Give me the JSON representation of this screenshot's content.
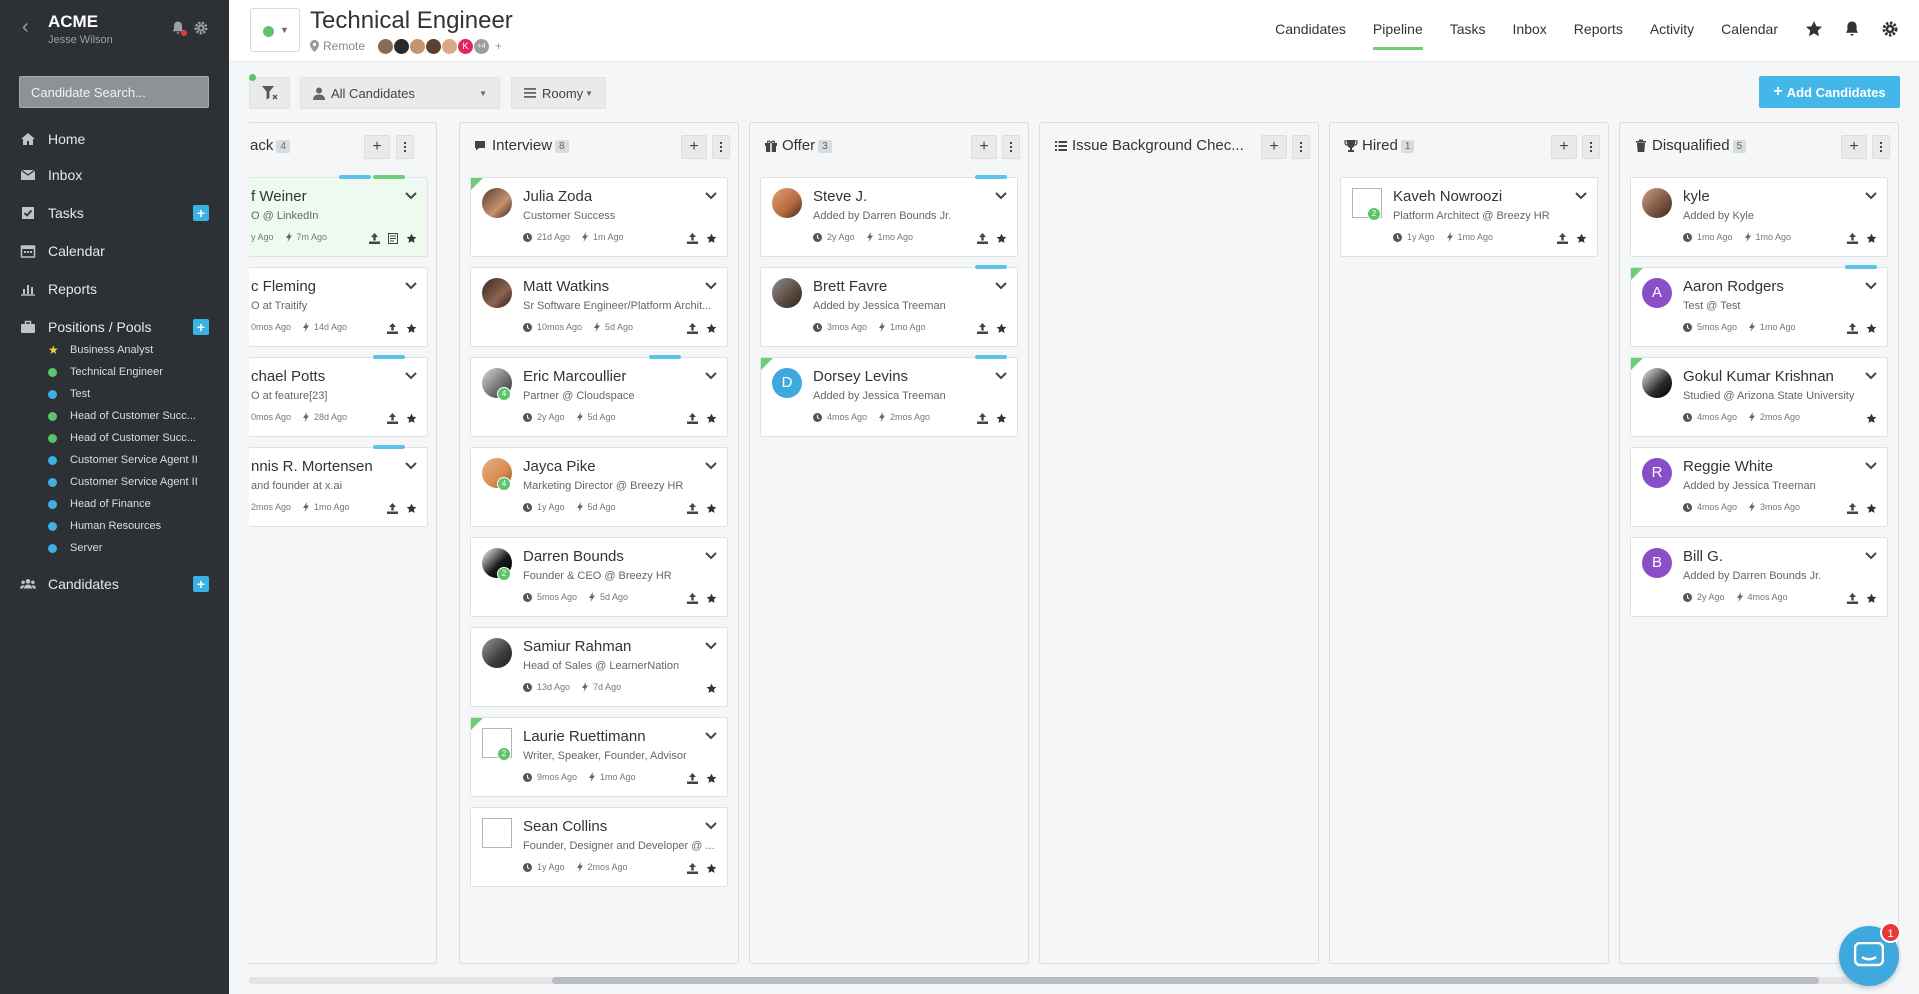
{
  "sidebar": {
    "company": "ACME",
    "user": "Jesse Wilson",
    "search_placeholder": "Candidate Search...",
    "nav": {
      "home": "Home",
      "inbox": "Inbox",
      "tasks": "Tasks",
      "calendar": "Calendar",
      "reports": "Reports",
      "positions": "Positions / Pools",
      "candidates": "Candidates"
    },
    "positions": [
      {
        "label": "Business Analyst",
        "marker": "star",
        "color": "#f4d03f"
      },
      {
        "label": "Technical Engineer",
        "marker": "dot",
        "color": "#5cc46a"
      },
      {
        "label": "Test",
        "marker": "dot",
        "color": "#3fb0e3"
      },
      {
        "label": "Head of Customer Succ...",
        "marker": "dot",
        "color": "#5cc46a"
      },
      {
        "label": "Head of Customer Succ...",
        "marker": "dot",
        "color": "#5cc46a"
      },
      {
        "label": "Customer Service Agent II",
        "marker": "dot",
        "color": "#3fb0e3"
      },
      {
        "label": "Customer Service Agent II",
        "marker": "dot",
        "color": "#3fb0e3"
      },
      {
        "label": "Head of Finance",
        "marker": "dot",
        "color": "#3fb0e3"
      },
      {
        "label": "Human Resources",
        "marker": "dot",
        "color": "#3fb0e3"
      },
      {
        "label": "Server",
        "marker": "dot",
        "color": "#3fb0e3"
      }
    ]
  },
  "header": {
    "title": "Technical Engineer",
    "location": "Remote",
    "team_more": "+4",
    "team_initial": "K",
    "nav": {
      "candidates": "Candidates",
      "pipeline": "Pipeline",
      "tasks": "Tasks",
      "inbox": "Inbox",
      "reports": "Reports",
      "activity": "Activity",
      "calendar": "Calendar"
    }
  },
  "toolbar": {
    "candidate_filter": "All Candidates",
    "view_mode": "Roomy",
    "add_button": "Add Candidates"
  },
  "columns": {
    "feedback": {
      "title": "ack",
      "count": "4",
      "cards": [
        {
          "name": "f Weiner",
          "sub": "O @ LinkedIn",
          "t1": "y Ago",
          "t2": "7m Ago"
        },
        {
          "name": "c Fleming",
          "sub": "O at Traitify",
          "t1": "0mos Ago",
          "t2": "14d Ago"
        },
        {
          "name": "chael Potts",
          "sub": "O at feature[23]",
          "t1": "0mos Ago",
          "t2": "28d Ago"
        },
        {
          "name": "nnis R. Mortensen",
          "sub": "and founder at x.ai",
          "t1": "2mos Ago",
          "t2": "1mo Ago"
        }
      ]
    },
    "interview": {
      "title": "Interview",
      "count": "8",
      "cards": [
        {
          "name": "Julia Zoda",
          "sub": "Customer Success",
          "t1": "21d Ago",
          "t2": "1m Ago"
        },
        {
          "name": "Matt Watkins",
          "sub": "Sr Software Engineer/Platform Archit...",
          "t1": "10mos Ago",
          "t2": "5d Ago"
        },
        {
          "name": "Eric Marcoullier",
          "sub": "Partner @ Cloudspace",
          "t1": "2y Ago",
          "t2": "5d Ago",
          "badge": "4"
        },
        {
          "name": "Jayca Pike",
          "sub": "Marketing Director @ Breezy HR",
          "t1": "1y Ago",
          "t2": "5d Ago",
          "badge": "4"
        },
        {
          "name": "Darren Bounds",
          "sub": "Founder & CEO @ Breezy HR",
          "t1": "5mos Ago",
          "t2": "5d Ago",
          "badge": "2"
        },
        {
          "name": "Samiur Rahman",
          "sub": "Head of Sales @ LearnerNation",
          "t1": "13d Ago",
          "t2": "7d Ago"
        },
        {
          "name": "Laurie Ruettimann",
          "sub": "Writer, Speaker, Founder, Advisor",
          "t1": "9mos Ago",
          "t2": "1mo Ago",
          "badge": "2"
        },
        {
          "name": "Sean Collins",
          "sub": "Founder, Designer and Developer @ ...",
          "t1": "1y Ago",
          "t2": "2mos Ago"
        }
      ]
    },
    "offer": {
      "title": "Offer",
      "count": "3",
      "cards": [
        {
          "name": "Steve J.",
          "sub": "Added by Darren Bounds Jr.",
          "t1": "2y Ago",
          "t2": "1mo Ago"
        },
        {
          "name": "Brett Favre",
          "sub": "Added by Jessica Treeman",
          "t1": "3mos Ago",
          "t2": "1mo Ago"
        },
        {
          "name": "Dorsey Levins",
          "sub": "Added by Jessica Treeman",
          "t1": "4mos Ago",
          "t2": "2mos Ago",
          "initial": "D"
        }
      ]
    },
    "background": {
      "title": "Issue Background Chec..."
    },
    "hired": {
      "title": "Hired",
      "count": "1",
      "cards": [
        {
          "name": "Kaveh Nowroozi",
          "sub": "Platform Architect @ Breezy HR",
          "t1": "1y Ago",
          "t2": "1mo Ago",
          "badge": "2"
        }
      ]
    },
    "disqualified": {
      "title": "Disqualified",
      "count": "5",
      "cards": [
        {
          "name": "kyle",
          "sub": "Added by Kyle",
          "t1": "1mo Ago",
          "t2": "1mo Ago"
        },
        {
          "name": "Aaron Rodgers",
          "sub": "Test @ Test",
          "t1": "5mos Ago",
          "t2": "1mo Ago",
          "initial": "A"
        },
        {
          "name": "Gokul Kumar Krishnan",
          "sub": "Studied @ Arizona State University",
          "t1": "4mos Ago",
          "t2": "2mos Ago"
        },
        {
          "name": "Reggie White",
          "sub": "Added by Jessica Treeman",
          "t1": "4mos Ago",
          "t2": "3mos Ago",
          "initial": "R"
        },
        {
          "name": "Bill G.",
          "sub": "Added by Darren Bounds Jr.",
          "t1": "2y Ago",
          "t2": "4mos Ago",
          "initial": "B"
        }
      ]
    }
  },
  "chat": {
    "unread": "1"
  },
  "colors": {
    "accent": "#44b7e9",
    "active_green": "#6ccf78",
    "sidebar_bg": "#2d3035"
  }
}
